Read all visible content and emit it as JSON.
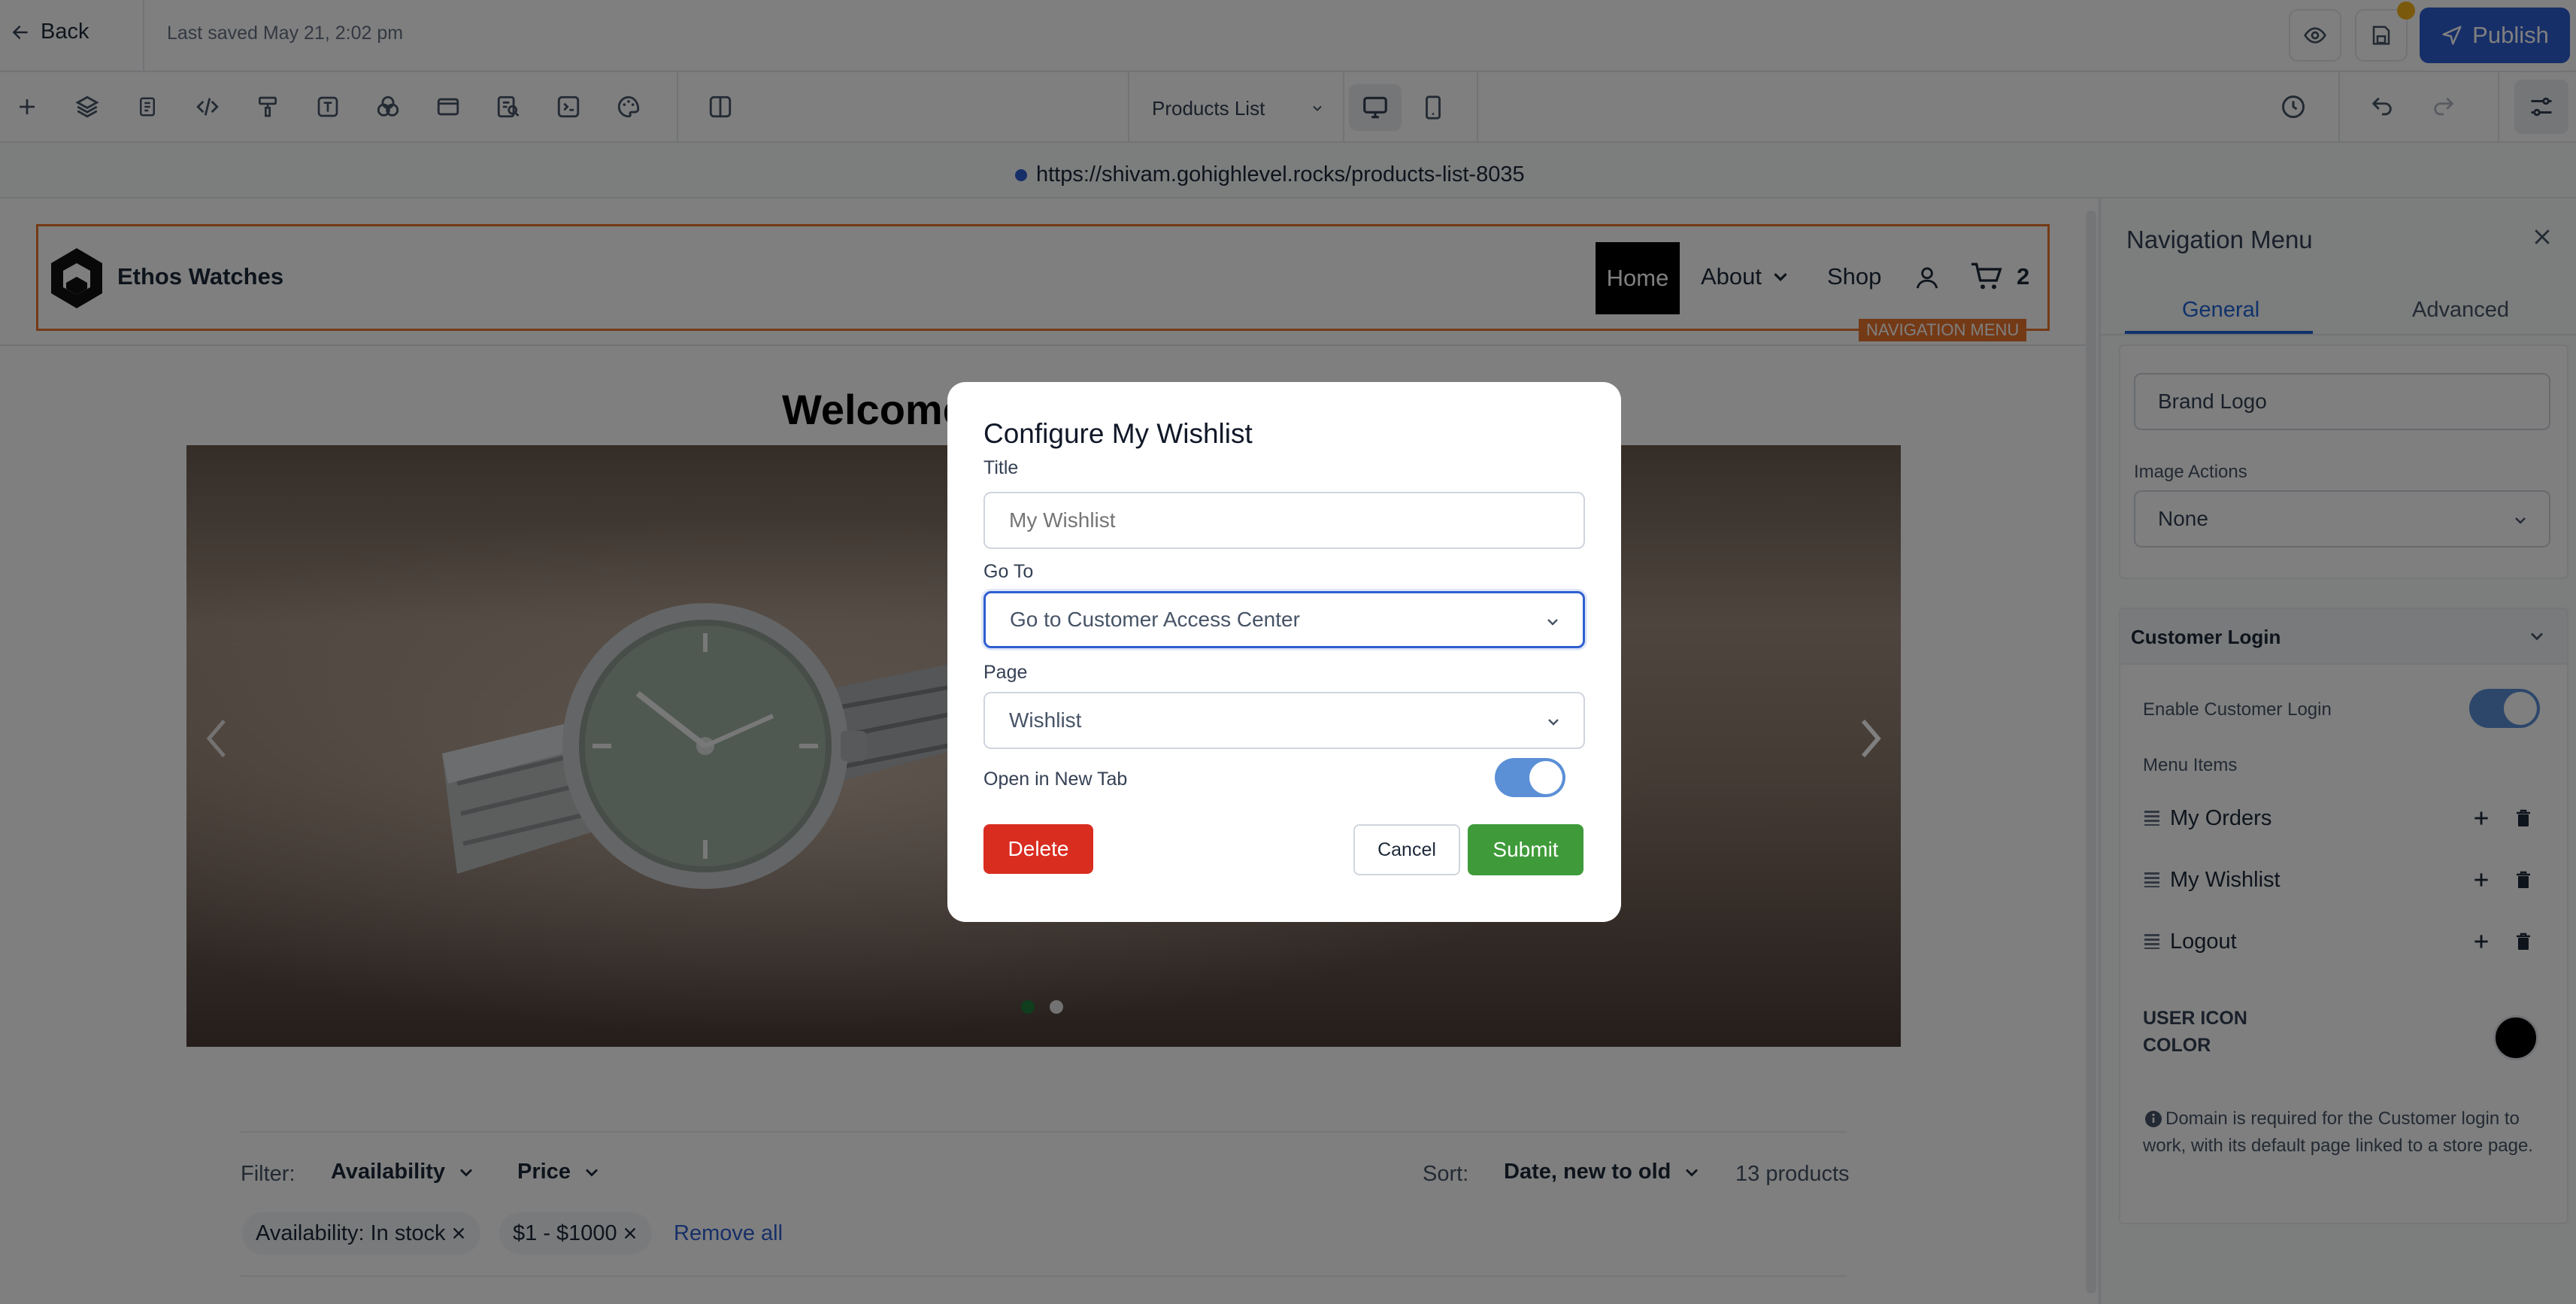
{
  "topbar": {
    "back_label": "Back",
    "last_saved": "Last saved May 21, 2:02 pm",
    "publish_label": "Publish"
  },
  "toolbar": {
    "page_select": "Products List",
    "icons": [
      "add-icon",
      "layers-icon",
      "pages-icon",
      "code-icon",
      "paint-roller-icon",
      "text-icon",
      "shapes-icon",
      "section-icon",
      "seo-icon",
      "terminal-icon",
      "palette-icon",
      "split-view-icon"
    ]
  },
  "url": "https://shivam.gohighlevel.rocks/products-list-8035",
  "site": {
    "brand": "Ethos Watches",
    "nav": {
      "home": "Home",
      "about": "About",
      "shop": "Shop",
      "cart_count": "2"
    },
    "element_tag": "NAVIGATION MENU",
    "hero_heading": "Welcome",
    "filter": {
      "label": "Filter:",
      "availability": "Availability",
      "price": "Price",
      "sort_label": "Sort:",
      "sort_value": "Date, new to old",
      "count": "13 products",
      "chip_availability": "Availability: In stock",
      "chip_price": "$1 - $1000",
      "remove_all": "Remove all"
    }
  },
  "panel": {
    "title": "Navigation Menu",
    "tabs": {
      "general": "General",
      "advanced": "Advanced"
    },
    "alt_text_value": "Brand Logo",
    "image_actions_label": "Image Actions",
    "image_actions_value": "None",
    "customer_login_header": "Customer Login",
    "enable_login_label": "Enable Customer Login",
    "enable_login": true,
    "menu_items_label": "Menu Items",
    "menu_items": [
      "My Orders",
      "My Wishlist",
      "Logout"
    ],
    "user_icon_color_label_1": "USER ICON",
    "user_icon_color_label_2": "COLOR",
    "user_icon_color": "#000000",
    "info_note": "Domain is required for the Customer login to work, with its default page linked to a store page."
  },
  "modal": {
    "title": "Configure My Wishlist",
    "title_label": "Title",
    "title_placeholder": "My Wishlist",
    "goto_label": "Go To",
    "goto_value": "Go to Customer Access Center",
    "page_label": "Page",
    "page_value": "Wishlist",
    "new_tab_label": "Open in New Tab",
    "new_tab": true,
    "delete_label": "Delete",
    "cancel_label": "Cancel",
    "submit_label": "Submit"
  },
  "colors": {
    "publish": "#2f5fd0",
    "accent_blue": "#155eef",
    "delete_red": "#d92d20",
    "submit_green": "#3f9b3a",
    "selection_orange": "#e8742c"
  }
}
